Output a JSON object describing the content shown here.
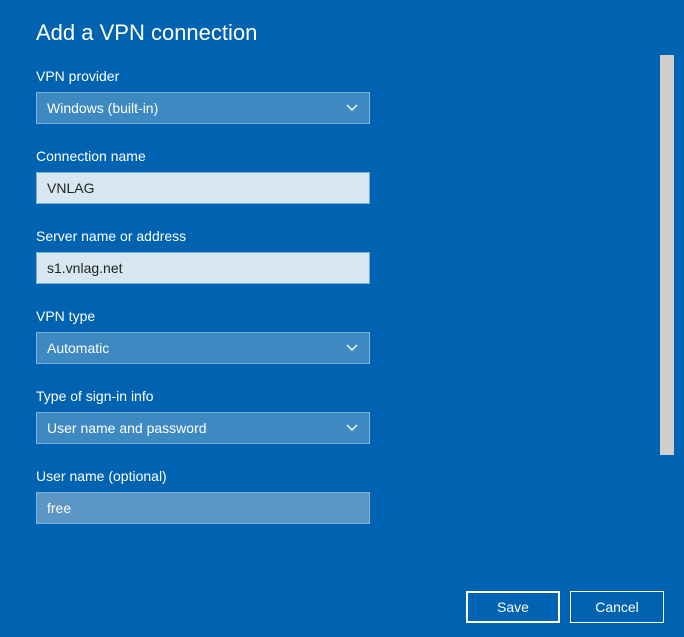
{
  "title": "Add a VPN connection",
  "fields": {
    "provider": {
      "label": "VPN provider",
      "value": "Windows (built-in)"
    },
    "connection_name": {
      "label": "Connection name",
      "value": "VNLAG"
    },
    "server": {
      "label": "Server name or address",
      "value": "s1.vnlag.net"
    },
    "vpn_type": {
      "label": "VPN type",
      "value": "Automatic"
    },
    "signin": {
      "label": "Type of sign-in info",
      "value": "User name and password"
    },
    "username": {
      "label": "User name (optional)",
      "value": "free"
    }
  },
  "buttons": {
    "save": "Save",
    "cancel": "Cancel"
  }
}
